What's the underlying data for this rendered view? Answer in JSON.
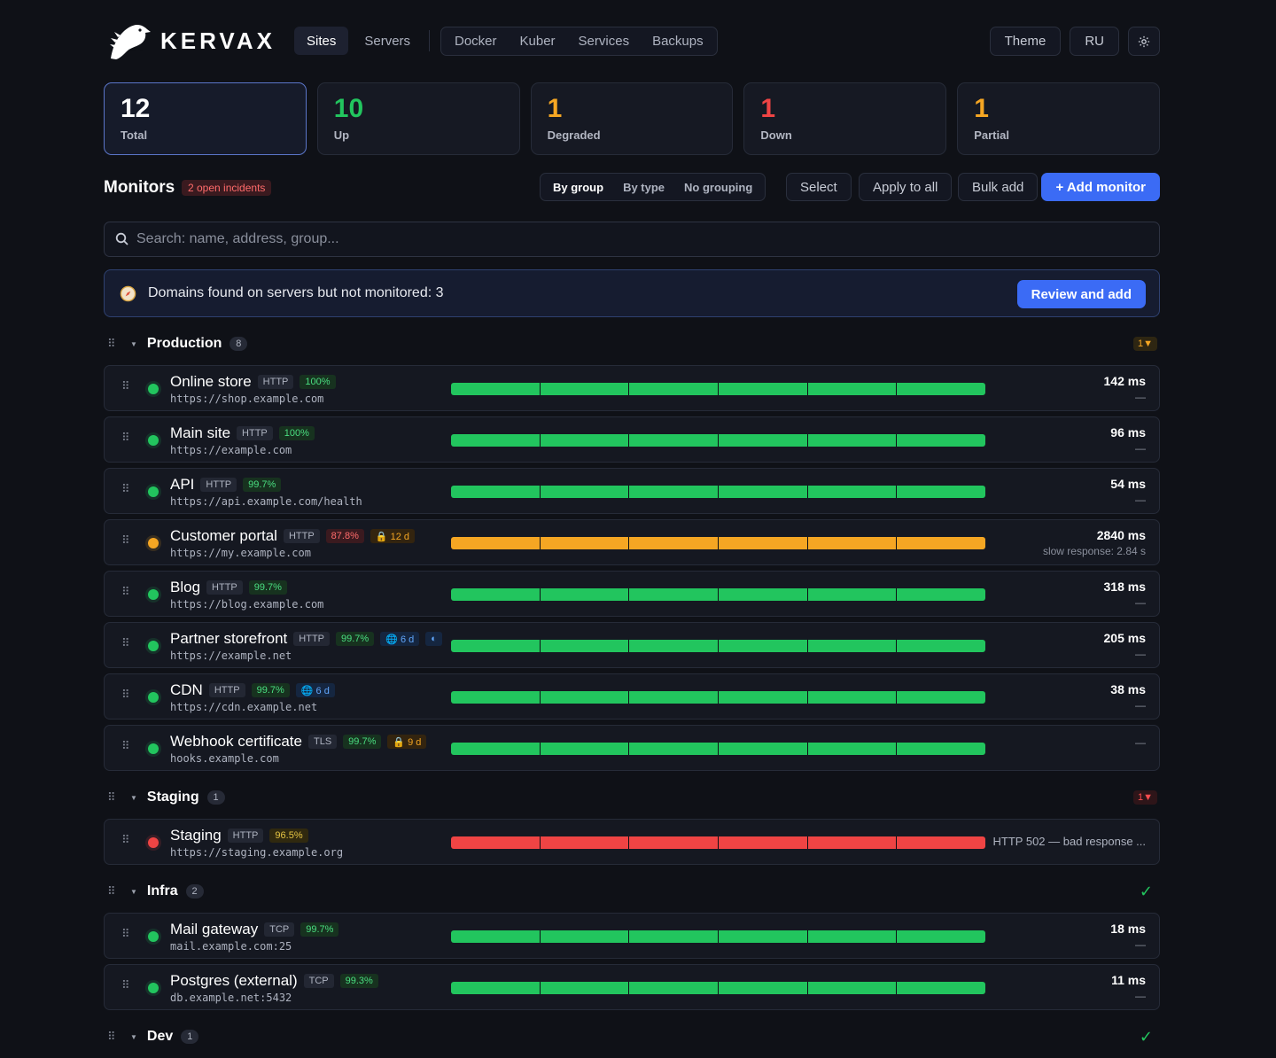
{
  "app": {
    "brand": "KERVAX"
  },
  "nav": {
    "primary": [
      {
        "label": "Sites",
        "active": true
      },
      {
        "label": "Servers",
        "active": false
      }
    ],
    "secondary": [
      "Docker",
      "Kuber",
      "Services",
      "Backups"
    ],
    "theme": "Theme",
    "lang": "RU"
  },
  "stats": [
    {
      "value": "12",
      "label": "Total",
      "color": "#ffffff"
    },
    {
      "value": "10",
      "label": "Up",
      "color": "#22c55e"
    },
    {
      "value": "1",
      "label": "Degraded",
      "color": "#f5a623"
    },
    {
      "value": "1",
      "label": "Down",
      "color": "#ef4444"
    },
    {
      "value": "1",
      "label": "Partial",
      "color": "#f5a623"
    }
  ],
  "toolbar": {
    "title": "Monitors",
    "incidents": "2 open incidents",
    "grouping": [
      "By group",
      "By type",
      "No grouping"
    ],
    "select": "Select",
    "apply_all": "Apply to all",
    "bulk_add": "Bulk add",
    "add_monitor": "+ Add monitor"
  },
  "search": {
    "placeholder": "Search: name, address, group..."
  },
  "banner": {
    "text": "Domains found on servers but not monitored: 3",
    "button": "Review and add"
  },
  "groups": [
    {
      "name": "Production",
      "count": "8",
      "status": "1▼",
      "status_kind": "warn",
      "monitors": [
        {
          "name": "Online store",
          "type": "HTTP",
          "uptime": "100%",
          "uptime_kind": "g",
          "address": "https://shop.example.com",
          "state": "up",
          "ms": "142 ms",
          "sub": "—"
        },
        {
          "name": "Main site",
          "type": "HTTP",
          "uptime": "100%",
          "uptime_kind": "g",
          "address": "https://example.com",
          "state": "up",
          "ms": "96 ms",
          "sub": "—"
        },
        {
          "name": "API",
          "type": "HTTP",
          "uptime": "99.7%",
          "uptime_kind": "g",
          "address": "https://api.example.com/health",
          "state": "up",
          "ms": "54 ms",
          "sub": "—"
        },
        {
          "name": "Customer portal",
          "type": "HTTP",
          "uptime": "87.8%",
          "uptime_kind": "r",
          "address": "https://my.example.com",
          "state": "deg",
          "ms": "2840 ms",
          "sub": "slow response: 2.84 s",
          "extra": [
            {
              "text": "🔒 12 d",
              "kind": "o"
            }
          ]
        },
        {
          "name": "Blog",
          "type": "HTTP",
          "uptime": "99.7%",
          "uptime_kind": "g",
          "address": "https://blog.example.com",
          "state": "up",
          "ms": "318 ms",
          "sub": "—"
        },
        {
          "name": "Partner storefront",
          "type": "HTTP",
          "uptime": "99.7%",
          "uptime_kind": "g",
          "address": "https://example.net",
          "state": "up",
          "ms": "205 ms",
          "sub": "—",
          "extra": [
            {
              "text": "🌐 6 d",
              "kind": "b"
            },
            {
              "text": "◐",
              "kind": "b"
            }
          ]
        },
        {
          "name": "CDN",
          "type": "HTTP",
          "uptime": "99.7%",
          "uptime_kind": "g",
          "address": "https://cdn.example.net",
          "state": "up",
          "ms": "38 ms",
          "sub": "—",
          "extra": [
            {
              "text": "🌐 6 d",
              "kind": "b"
            }
          ]
        },
        {
          "name": "Webhook certificate",
          "type": "TLS",
          "uptime": "99.7%",
          "uptime_kind": "g",
          "address": "hooks.example.com",
          "state": "up",
          "ms": "",
          "sub": "—",
          "extra": [
            {
              "text": "🔒 9 d",
              "kind": "o"
            }
          ]
        }
      ]
    },
    {
      "name": "Staging",
      "count": "1",
      "status": "1▼",
      "status_kind": "bad",
      "monitors": [
        {
          "name": "Staging",
          "type": "HTTP",
          "uptime": "96.5%",
          "uptime_kind": "y",
          "address": "https://staging.example.org",
          "state": "down",
          "ms": "HTTP 502 — bad response ...",
          "sub": "",
          "mid": true
        }
      ]
    },
    {
      "name": "Infra",
      "count": "2",
      "status": "✓",
      "status_kind": "ok",
      "monitors": [
        {
          "name": "Mail gateway",
          "type": "TCP",
          "uptime": "99.7%",
          "uptime_kind": "g",
          "address": "mail.example.com:25",
          "state": "up",
          "ms": "18 ms",
          "sub": "—"
        },
        {
          "name": "Postgres (external)",
          "type": "TCP",
          "uptime": "99.3%",
          "uptime_kind": "g",
          "address": "db.example.net:5432",
          "state": "up",
          "ms": "11 ms",
          "sub": "—"
        }
      ]
    },
    {
      "name": "Dev",
      "count": "1",
      "status": "✓",
      "status_kind": "ok",
      "monitors": []
    }
  ]
}
